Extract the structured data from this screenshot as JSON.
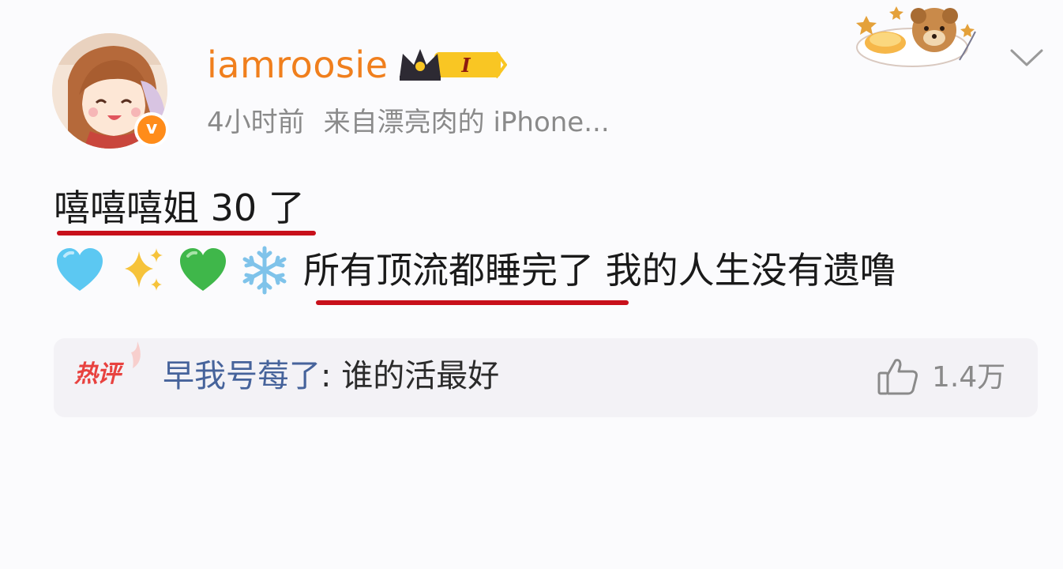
{
  "post": {
    "username": "iamroosie",
    "member_badge_level": "I",
    "time": "4小时前",
    "source": "来自漂亮肉的 iPhone...",
    "verified_mark": "v",
    "line1": "嘻嘻嘻姐 30 了",
    "line2_emojis": [
      "light-blue-heart",
      "sparkles",
      "green-heart",
      "snowflake"
    ],
    "line2_text": "所有顶流都睡完了 我的人生没有遗噜"
  },
  "hot_comment": {
    "tag": "热评",
    "author": "早我号莓了",
    "separator": ": ",
    "text": "谁的活最好",
    "likes": "1.4万"
  },
  "colors": {
    "username": "#f07f1d",
    "meta": "#8a8a8a",
    "underline": "#c8101b",
    "hot_tag": "#e8423f",
    "comment_author": "#46639b",
    "comment_bg": "#f3f2f6"
  }
}
